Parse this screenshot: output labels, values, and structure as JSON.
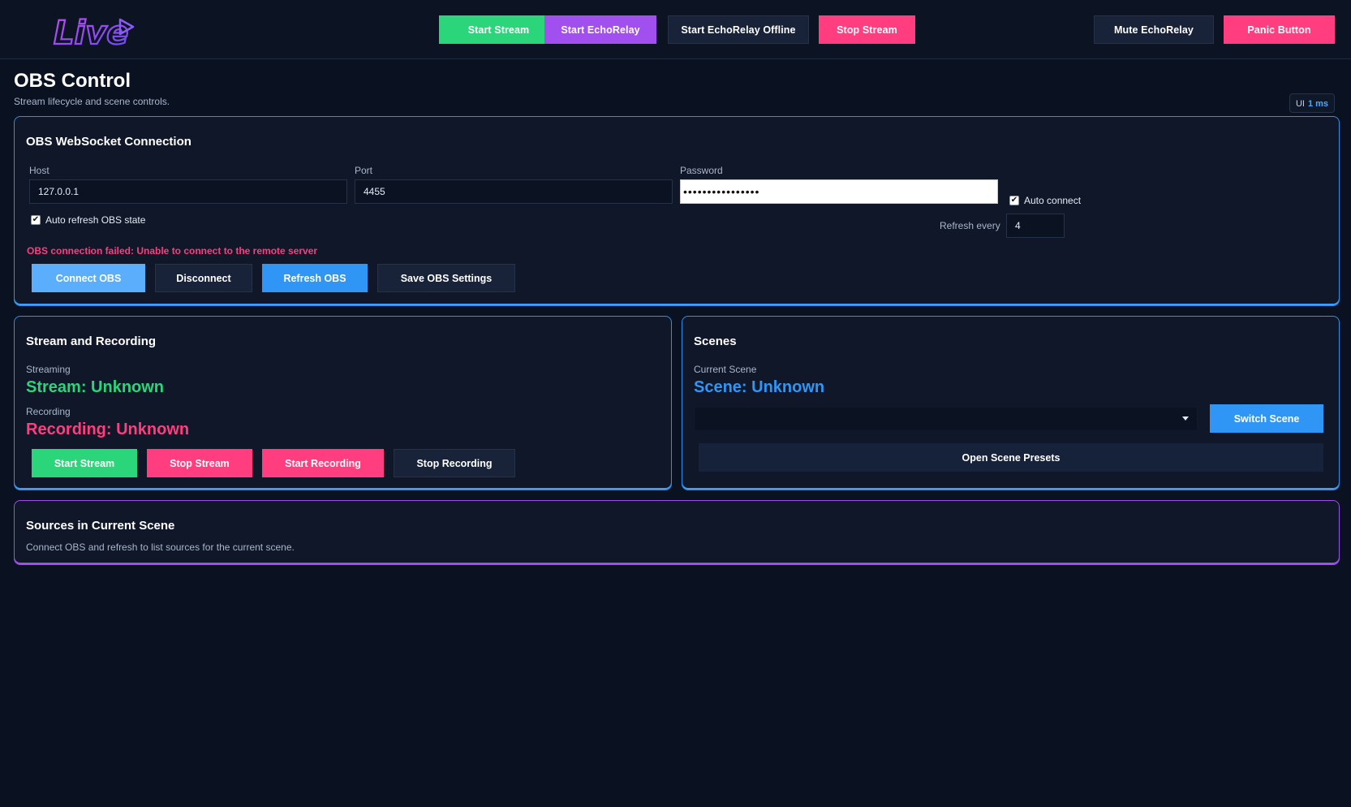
{
  "brand": {
    "logo_text": "Live"
  },
  "topbar": {
    "buttons": [
      {
        "label": "Start Stream"
      },
      {
        "label": "Start EchoRelay"
      },
      {
        "label": "Start EchoRelay Offline"
      },
      {
        "label": "Stop Stream"
      },
      {
        "label": "Mute EchoRelay"
      },
      {
        "label": "Panic Button"
      }
    ]
  },
  "page": {
    "title": "OBS Control",
    "subtitle": "Stream lifecycle and scene controls.",
    "ui_label": "UI",
    "ui_ms": "1 ms"
  },
  "connection": {
    "title": "OBS WebSocket Connection",
    "host_label": "Host",
    "host_value": "127.0.0.1",
    "port_label": "Port",
    "port_value": "4455",
    "password_label": "Password",
    "password_value": "••••••••••••••••",
    "auto_connect_label": "Auto connect",
    "auto_connect_checked": true,
    "auto_refresh_label": "Auto refresh OBS state",
    "auto_refresh_checked": true,
    "refresh_every_label": "Refresh every",
    "refresh_every_value": "4",
    "error": "OBS connection failed: Unable to connect to the remote server",
    "buttons": {
      "connect": "Connect OBS",
      "disconnect": "Disconnect",
      "refresh": "Refresh OBS",
      "save": "Save OBS Settings"
    }
  },
  "stream_recording": {
    "title": "Stream and Recording",
    "streaming_label": "Streaming",
    "stream_status": "Stream: Unknown",
    "recording_label": "Recording",
    "recording_status": "Recording: Unknown",
    "buttons": {
      "start_stream": "Start Stream",
      "stop_stream": "Stop Stream",
      "start_recording": "Start Recording",
      "stop_recording": "Stop Recording"
    }
  },
  "scenes": {
    "title": "Scenes",
    "current_label": "Current Scene",
    "current_status": "Scene: Unknown",
    "selected": "",
    "switch_button": "Switch Scene",
    "presets_button": "Open Scene Presets"
  },
  "sources": {
    "title": "Sources in Current Scene",
    "message": "Connect OBS and refresh to list sources for the current scene."
  },
  "colors": {
    "background": "#0a1120",
    "green": "#2bd67b",
    "purple": "#a24ff0",
    "pink": "#ff3d7f",
    "blue": "#2f96f5",
    "card_border": "#2e8fe6"
  }
}
